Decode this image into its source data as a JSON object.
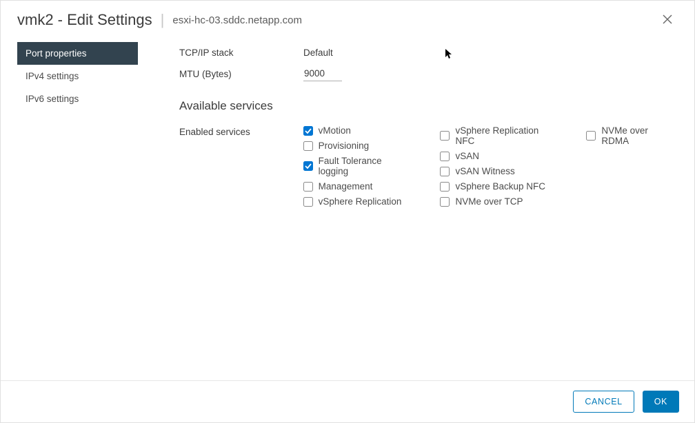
{
  "header": {
    "title": "vmk2 - Edit Settings",
    "host": "esxi-hc-03.sddc.netapp.com"
  },
  "sidebar": {
    "items": [
      {
        "label": "Port properties",
        "active": true
      },
      {
        "label": "IPv4 settings",
        "active": false
      },
      {
        "label": "IPv6 settings",
        "active": false
      }
    ]
  },
  "form": {
    "tcpip_label": "TCP/IP stack",
    "tcpip_value": "Default",
    "mtu_label": "MTU (Bytes)",
    "mtu_value": "9000",
    "available_services_title": "Available services",
    "enabled_services_label": "Enabled services",
    "services": {
      "col1": [
        {
          "label": "vMotion",
          "checked": true
        },
        {
          "label": "Provisioning",
          "checked": false
        },
        {
          "label": "Fault Tolerance logging",
          "checked": true
        },
        {
          "label": "Management",
          "checked": false
        },
        {
          "label": "vSphere Replication",
          "checked": false
        }
      ],
      "col2": [
        {
          "label": "vSphere Replication NFC",
          "checked": false
        },
        {
          "label": "vSAN",
          "checked": false
        },
        {
          "label": "vSAN Witness",
          "checked": false
        },
        {
          "label": "vSphere Backup NFC",
          "checked": false
        },
        {
          "label": "NVMe over TCP",
          "checked": false
        }
      ],
      "col3": [
        {
          "label": "NVMe over RDMA",
          "checked": false
        }
      ]
    }
  },
  "footer": {
    "cancel": "CANCEL",
    "ok": "OK"
  }
}
